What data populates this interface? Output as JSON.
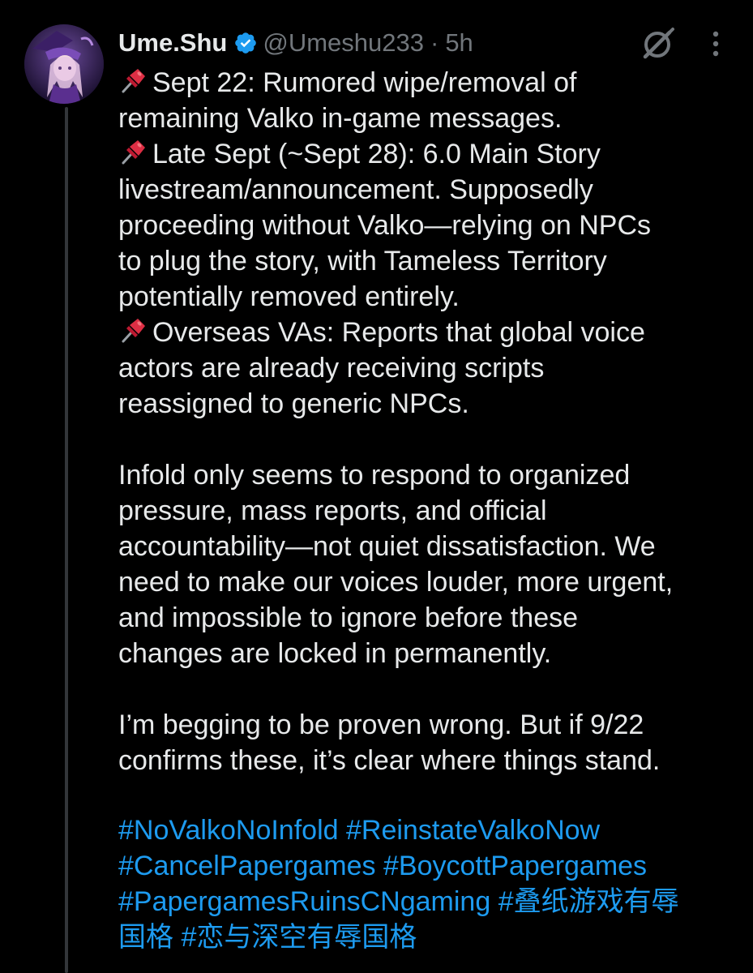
{
  "post": {
    "author": {
      "display_name": "Ume.Shu",
      "handle": "@Umeshu233",
      "separator": "·",
      "timestamp": "5h",
      "verified": true
    },
    "icons": {
      "avatar": "avatar-image",
      "verified": "verified-badge-icon",
      "grok": "grok-icon",
      "more": "more-options-icon",
      "pin": "pushpin-icon"
    },
    "body_lines": [
      {
        "pin": true,
        "text": "Sept 22: Rumored wipe/removal of"
      },
      {
        "pin": false,
        "text": "remaining Valko in-game messages."
      },
      {
        "pin": true,
        "text": "Late Sept (~Sept 28): 6.0 Main Story"
      },
      {
        "pin": false,
        "text": "livestream/announcement. Supposedly"
      },
      {
        "pin": false,
        "text": "proceeding without Valko—relying on NPCs"
      },
      {
        "pin": false,
        "text": "to plug the story, with Tameless Territory"
      },
      {
        "pin": false,
        "text": "potentially removed entirely."
      },
      {
        "pin": true,
        "text": "Overseas VAs: Reports that global voice"
      },
      {
        "pin": false,
        "text": "actors are already receiving scripts"
      },
      {
        "pin": false,
        "text": "reassigned to generic NPCs."
      },
      {
        "blank": true
      },
      {
        "pin": false,
        "text": "Infold only seems to respond to organized"
      },
      {
        "pin": false,
        "text": "pressure, mass reports, and official"
      },
      {
        "pin": false,
        "text": "accountability—not quiet dissatisfaction. We"
      },
      {
        "pin": false,
        "text": "need to make our voices louder, more urgent,"
      },
      {
        "pin": false,
        "text": "and impossible to ignore before these"
      },
      {
        "pin": false,
        "text": "changes are locked in permanently."
      },
      {
        "blank": true
      },
      {
        "pin": false,
        "text": "I’m begging to be proven wrong. But if 9/22"
      },
      {
        "pin": false,
        "text": "confirms these, it’s clear where things stand."
      }
    ],
    "hashtag_lines": [
      [
        "#NoValkoNoInfold",
        "#ReinstateValkoNow"
      ],
      [
        "#CancelPapergames",
        "#BoycottPapergames"
      ],
      [
        "#PapergamesRuinsCNgaming",
        "#叠纸游戏有辱"
      ],
      [
        "国格",
        "#恋与深空有辱国格"
      ]
    ],
    "colors": {
      "background": "#000000",
      "text": "#e7e9ea",
      "secondary_text": "#71767b",
      "link": "#1d9bf0",
      "verified": "#1d9bf0",
      "thread_line": "#333639"
    }
  }
}
